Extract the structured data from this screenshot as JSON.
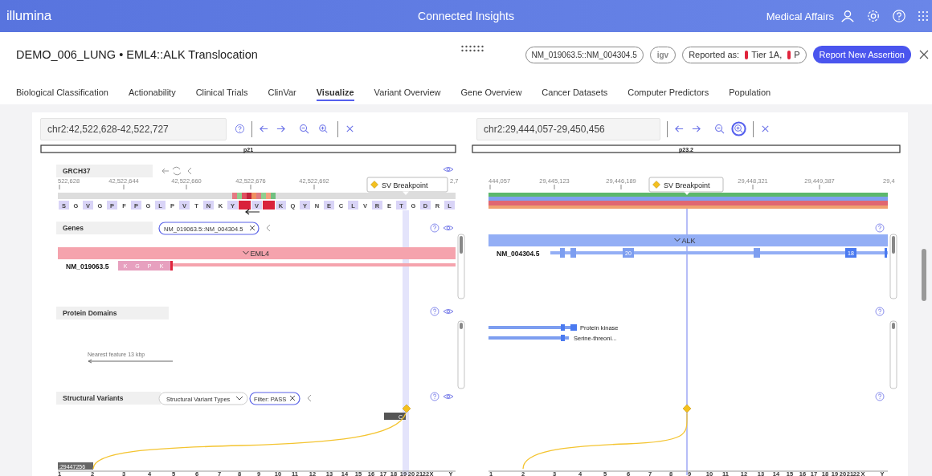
{
  "header": {
    "logo": "illumina",
    "app_title": "Connected Insights",
    "user": "Medical Affairs"
  },
  "case": {
    "title": "DEMO_006_LUNG • EML4::ALK Translocation",
    "transcript_chip": "NM_019063.5::NM_004304.5",
    "igv_button": "igv",
    "reported_label": "Reported as:",
    "tiers": [
      {
        "label": "Tier 1A,",
        "color": "#e0243c"
      },
      {
        "label": "P",
        "color": "#e0243c"
      }
    ],
    "report_button": "Report New Assertion"
  },
  "tabs": [
    {
      "label": "Biological Classification",
      "selected": false
    },
    {
      "label": "Actionability",
      "selected": false
    },
    {
      "label": "Clinical Trials",
      "selected": false
    },
    {
      "label": "ClinVar",
      "selected": false
    },
    {
      "label": "Visualize",
      "selected": true
    },
    {
      "label": "Variant Overview",
      "selected": false
    },
    {
      "label": "Gene Overview",
      "selected": false
    },
    {
      "label": "Cancer Datasets",
      "selected": false
    },
    {
      "label": "Computer Predictors",
      "selected": false
    },
    {
      "label": "Population",
      "selected": false
    }
  ],
  "panels": [
    {
      "locus": "chr2:42,522,628-42,522,727",
      "help_icon": true,
      "eye_icons": true,
      "zoom_in_focused": false,
      "cytoband": "p21",
      "reference": "GRCH37",
      "ruler": [
        "522,628",
        "42,522,644",
        "42,522,660",
        "42,522,676",
        "42,522,692",
        "2,7"
      ],
      "breakpoint_label": "SV Breakpoint",
      "sequence": [
        {
          "aa": "S",
          "kind": "residue"
        },
        {
          "aa": "G",
          "kind": "residue"
        },
        {
          "aa": "V",
          "kind": "residue"
        },
        {
          "aa": "G",
          "kind": "residue"
        },
        {
          "aa": "P",
          "kind": "residue"
        },
        {
          "aa": "F",
          "kind": "residue"
        },
        {
          "aa": "P",
          "kind": "residue"
        },
        {
          "aa": "G",
          "kind": "residue"
        },
        {
          "aa": "L",
          "kind": "residue"
        },
        {
          "aa": "P",
          "kind": "residue"
        },
        {
          "aa": "V",
          "kind": "residue"
        },
        {
          "aa": "T",
          "kind": "residue"
        },
        {
          "aa": "N",
          "kind": "residue"
        },
        {
          "aa": "K",
          "kind": "residue"
        },
        {
          "aa": "Y",
          "kind": "residue"
        },
        {
          "kind": "mutant"
        },
        {
          "aa": "V",
          "kind": "residue"
        },
        {
          "kind": "mutant"
        },
        {
          "aa": "K",
          "kind": "residue"
        },
        {
          "aa": "Q",
          "kind": "residue"
        },
        {
          "aa": "Y",
          "kind": "residue"
        },
        {
          "aa": "N",
          "kind": "residue"
        },
        {
          "aa": "E",
          "kind": "residue"
        },
        {
          "aa": "C",
          "kind": "residue"
        },
        {
          "aa": "L",
          "kind": "residue"
        },
        {
          "aa": "V",
          "kind": "residue"
        },
        {
          "aa": "R",
          "kind": "residue"
        },
        {
          "aa": "E",
          "kind": "residue"
        },
        {
          "aa": "T",
          "kind": "residue"
        },
        {
          "aa": "G",
          "kind": "residue"
        },
        {
          "aa": "D",
          "kind": "residue"
        },
        {
          "aa": "R",
          "kind": "residue"
        },
        {
          "aa": "L",
          "kind": "residue"
        }
      ],
      "genes_label": "Genes",
      "genes_chip": "NM_019063.5::NM_004304.5",
      "gene": {
        "name": "EML4",
        "transcript": "NM_019063.5",
        "color": "#f5a3ad",
        "exon_labels": [
          "K",
          "G",
          "P",
          "K"
        ]
      },
      "domains_label": "Protein Domains",
      "domains_note": "Nearest feature 13 kbp",
      "sv_label": "Structural Variants",
      "sv_type_dropdown": "Structural Variant Types",
      "sv_filter": "Filter: PASS",
      "partner_position": ":29447256",
      "partner_base": "C",
      "chromosomes": [
        "1",
        "2",
        "3",
        "4",
        "5",
        "6",
        "7",
        "8",
        "9",
        "10",
        "11",
        "12",
        "13",
        "14",
        "15",
        "16",
        "17",
        "18",
        "19",
        "20",
        "21",
        "22",
        "X",
        "Y"
      ]
    },
    {
      "locus": "chr2:29,444,057-29,450,456",
      "help_icon": false,
      "eye_icons": false,
      "zoom_in_focused": true,
      "cytoband": "p23.2",
      "ruler": [
        "444,057",
        "29,445,123",
        "29,446,189",
        "29,448,321",
        "29,449,387",
        "29,4"
      ],
      "breakpoint_label": "SV Breakpoint",
      "gene": {
        "name": "ALK",
        "transcript": "NM_004304.5",
        "color": "#93aef5",
        "exon_labels": [
          "20",
          "18"
        ]
      },
      "domains": [
        "Protein kinase",
        "Serine-threoni..."
      ],
      "chromosomes": [
        "1",
        "2",
        "3",
        "4",
        "5",
        "6",
        "7",
        "8",
        "9",
        "10",
        "11",
        "12",
        "13",
        "14",
        "15",
        "16",
        "17",
        "18",
        "19",
        "20",
        "21",
        "22",
        "X",
        "Y"
      ]
    }
  ]
}
